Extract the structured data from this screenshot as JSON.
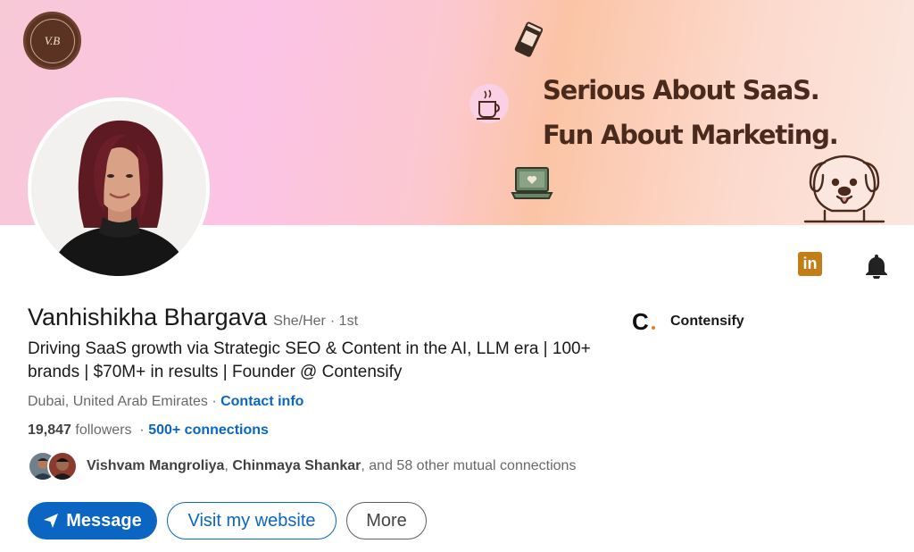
{
  "banner": {
    "badge_text": "V.B",
    "headline_line1": "Serious About SaaS.",
    "headline_line2": "Fun About Marketing.",
    "deco_icons": [
      "coffee-bag-icon",
      "coffee-cup-icon",
      "laptop-heart-icon",
      "dog-icon"
    ]
  },
  "profile": {
    "name": "Vanhishikha Bhargava",
    "pronouns": "She/Her",
    "degree": "· 1st",
    "headline": "Driving SaaS growth via Strategic SEO & Content in the AI, LLM era | 100+ brands | $70M+ in results | Founder @ Contensify",
    "location": "Dubai, United Arab Emirates",
    "location_sep": " · ",
    "contact_info": "Contact info",
    "followers_count": "19,847",
    "followers_label": " followers",
    "connections_sep": "  · ",
    "connections": "500+ connections",
    "mutual_name1": "Vishvam Mangroliya",
    "mutual_sep": ", ",
    "mutual_name2": "Chinmaya Shankar",
    "mutual_rest": ", and 58 other mutual connections"
  },
  "company": {
    "logo_letter": "C",
    "name": "Contensify"
  },
  "icons": {
    "linkedin": "linkedin-icon",
    "bell": "bell-icon",
    "send": "send-icon"
  },
  "actions": {
    "message": "Message",
    "website": "Visit my website",
    "more": "More"
  },
  "colors": {
    "accent": "#0a66c2",
    "badge_bg": "#5a3322",
    "banner_text": "#4a2a1d",
    "linkedin_icon_bg": "#c37d16"
  }
}
